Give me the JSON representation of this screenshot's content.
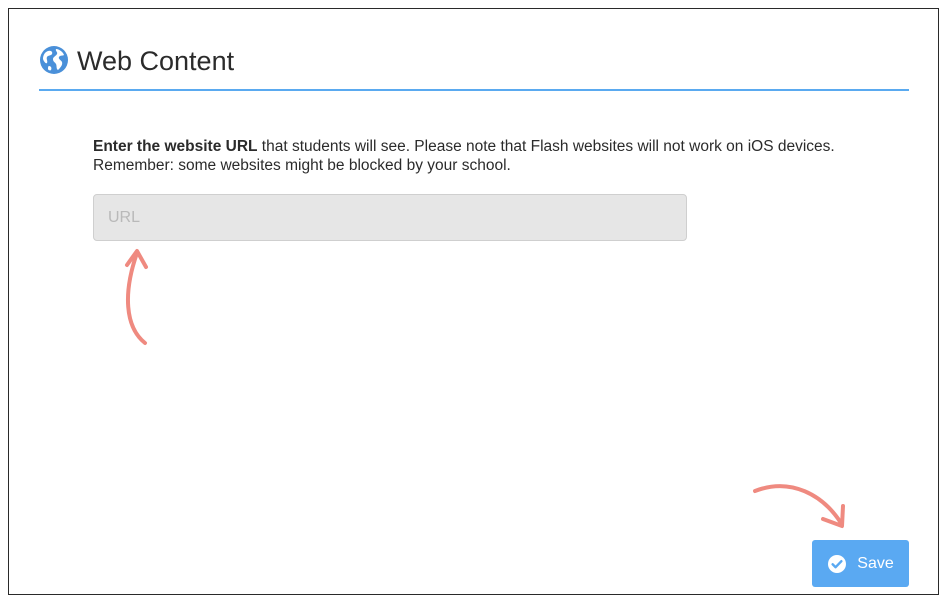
{
  "header": {
    "title": "Web Content",
    "icon": "globe-icon",
    "icon_color": "#4a90d9",
    "rule_color": "#5aaaf0"
  },
  "description": {
    "bold_lead": "Enter the website URL",
    "text_line1": " that students will see. Please note that Flash websites will not work on iOS devices.",
    "text_line2": "Remember: some websites might be blocked by your school."
  },
  "url_field": {
    "placeholder": "URL",
    "value": ""
  },
  "save_button": {
    "label": "Save",
    "icon": "check-circle-icon",
    "color": "#5aa9f2"
  },
  "annotations": {
    "arrow_color": "#ef8a80"
  }
}
